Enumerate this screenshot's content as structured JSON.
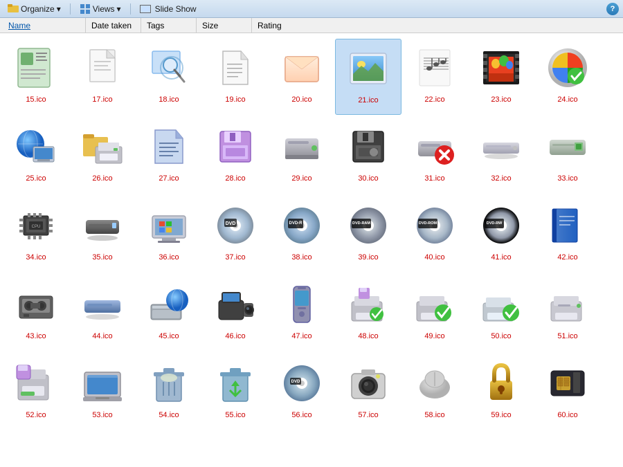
{
  "toolbar": {
    "organize_label": "Organize",
    "views_label": "Views",
    "slideshow_label": "Slide Show",
    "help_label": "?"
  },
  "columns": [
    {
      "label": "Name"
    },
    {
      "label": "Date taken"
    },
    {
      "label": "Tags"
    },
    {
      "label": "Size"
    },
    {
      "label": "Rating"
    }
  ],
  "icons": [
    {
      "id": "15",
      "label": "15.ico",
      "type": "document-layout"
    },
    {
      "id": "17",
      "label": "17.ico",
      "type": "empty-doc"
    },
    {
      "id": "18",
      "label": "18.ico",
      "type": "search-folder"
    },
    {
      "id": "19",
      "label": "19.ico",
      "type": "blank-doc"
    },
    {
      "id": "20",
      "label": "20.ico",
      "type": "email"
    },
    {
      "id": "21",
      "label": "21.ico",
      "type": "photo",
      "selected": true
    },
    {
      "id": "22",
      "label": "22.ico",
      "type": "music-sheet"
    },
    {
      "id": "23",
      "label": "23.ico",
      "type": "film-strip"
    },
    {
      "id": "24",
      "label": "24.ico",
      "type": "windows-ball"
    },
    {
      "id": "25",
      "label": "25.ico",
      "type": "computer-globe"
    },
    {
      "id": "26",
      "label": "26.ico",
      "type": "folder-printer"
    },
    {
      "id": "27",
      "label": "27.ico",
      "type": "blue-doc"
    },
    {
      "id": "28",
      "label": "28.ico",
      "type": "floppy-purple"
    },
    {
      "id": "29",
      "label": "29.ico",
      "type": "drive-box"
    },
    {
      "id": "30",
      "label": "30.ico",
      "type": "floppy-black"
    },
    {
      "id": "31",
      "label": "31.ico",
      "type": "drive-x"
    },
    {
      "id": "32",
      "label": "32.ico",
      "type": "drive-slim"
    },
    {
      "id": "33",
      "label": "33.ico",
      "type": "drive-battery"
    },
    {
      "id": "34",
      "label": "34.ico",
      "type": "chip"
    },
    {
      "id": "35",
      "label": "35.ico",
      "type": "drive-flat"
    },
    {
      "id": "36",
      "label": "36.ico",
      "type": "drive-windows"
    },
    {
      "id": "37",
      "label": "37.ico",
      "type": "dvd-disc"
    },
    {
      "id": "38",
      "label": "38.ico",
      "type": "dvd-r"
    },
    {
      "id": "39",
      "label": "39.ico",
      "type": "dvd-ram"
    },
    {
      "id": "40",
      "label": "40.ico",
      "type": "dvd-rom"
    },
    {
      "id": "41",
      "label": "41.ico",
      "type": "dvd-rw"
    },
    {
      "id": "42",
      "label": "42.ico",
      "type": "book-blue"
    },
    {
      "id": "43",
      "label": "43.ico",
      "type": "tape-drive"
    },
    {
      "id": "44",
      "label": "44.ico",
      "type": "drive-blue"
    },
    {
      "id": "45",
      "label": "45.ico",
      "type": "scanner-globe"
    },
    {
      "id": "46",
      "label": "46.ico",
      "type": "camcorder"
    },
    {
      "id": "47",
      "label": "47.ico",
      "type": "phone"
    },
    {
      "id": "48",
      "label": "48.ico",
      "type": "printer-floppy"
    },
    {
      "id": "49",
      "label": "49.ico",
      "type": "printer-check"
    },
    {
      "id": "50",
      "label": "50.ico",
      "type": "printer-check2"
    },
    {
      "id": "51",
      "label": "51.ico",
      "type": "printer-plain"
    },
    {
      "id": "52",
      "label": "52.ico",
      "type": "floppy-printer"
    },
    {
      "id": "53",
      "label": "53.ico",
      "type": "laptop"
    },
    {
      "id": "54",
      "label": "54.ico",
      "type": "trash-full"
    },
    {
      "id": "55",
      "label": "55.ico",
      "type": "recycle"
    },
    {
      "id": "56",
      "label": "56.ico",
      "type": "dvd-plain"
    },
    {
      "id": "57",
      "label": "57.ico",
      "type": "camera"
    },
    {
      "id": "58",
      "label": "58.ico",
      "type": "mouse"
    },
    {
      "id": "59",
      "label": "59.ico",
      "type": "padlock"
    },
    {
      "id": "60",
      "label": "60.ico",
      "type": "chip-card"
    }
  ]
}
